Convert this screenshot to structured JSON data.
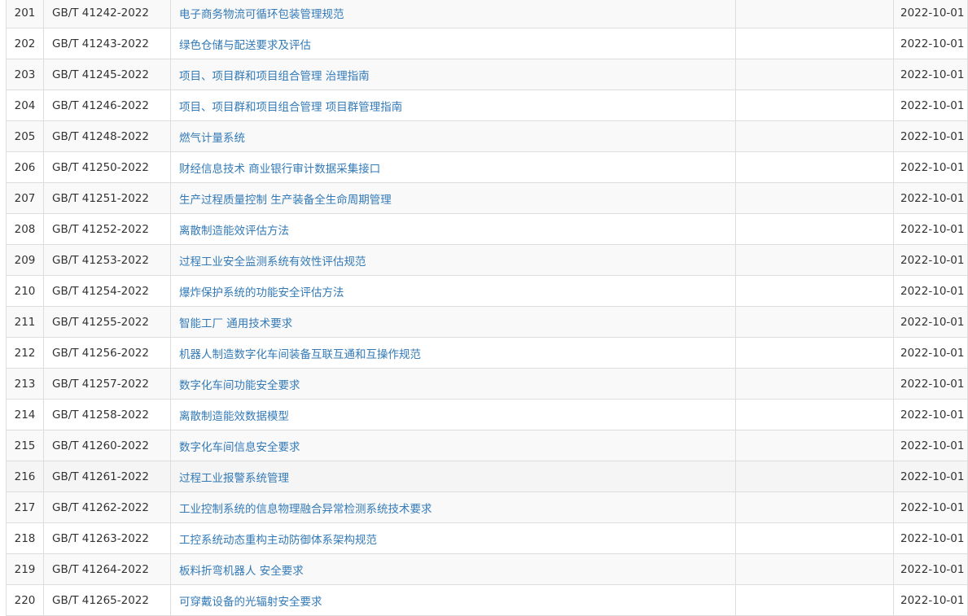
{
  "rows": [
    {
      "no": "201",
      "code": "GB/T 41242-2022",
      "title": "电子商务物流可循环包装管理规范",
      "note": "",
      "date": "2022-10-01"
    },
    {
      "no": "202",
      "code": "GB/T 41243-2022",
      "title": "绿色仓储与配送要求及评估",
      "note": "",
      "date": "2022-10-01"
    },
    {
      "no": "203",
      "code": "GB/T 41245-2022",
      "title": "项目、项目群和项目组合管理 治理指南",
      "note": "",
      "date": "2022-10-01"
    },
    {
      "no": "204",
      "code": "GB/T 41246-2022",
      "title": "项目、项目群和项目组合管理 项目群管理指南",
      "note": "",
      "date": "2022-10-01"
    },
    {
      "no": "205",
      "code": "GB/T 41248-2022",
      "title": "燃气计量系统",
      "note": "",
      "date": "2022-10-01"
    },
    {
      "no": "206",
      "code": "GB/T 41250-2022",
      "title": "财经信息技术 商业银行审计数据采集接口",
      "note": "",
      "date": "2022-10-01"
    },
    {
      "no": "207",
      "code": "GB/T 41251-2022",
      "title": "生产过程质量控制 生产装备全生命周期管理",
      "note": "",
      "date": "2022-10-01"
    },
    {
      "no": "208",
      "code": "GB/T 41252-2022",
      "title": "离散制造能效评估方法",
      "note": "",
      "date": "2022-10-01"
    },
    {
      "no": "209",
      "code": "GB/T 41253-2022",
      "title": "过程工业安全监测系统有效性评估规范",
      "note": "",
      "date": "2022-10-01"
    },
    {
      "no": "210",
      "code": "GB/T 41254-2022",
      "title": "爆炸保护系统的功能安全评估方法",
      "note": "",
      "date": "2022-10-01"
    },
    {
      "no": "211",
      "code": "GB/T 41255-2022",
      "title": "智能工厂 通用技术要求",
      "note": "",
      "date": "2022-10-01"
    },
    {
      "no": "212",
      "code": "GB/T 41256-2022",
      "title": "机器人制造数字化车间装备互联互通和互操作规范",
      "note": "",
      "date": "2022-10-01"
    },
    {
      "no": "213",
      "code": "GB/T 41257-2022",
      "title": "数字化车间功能安全要求",
      "note": "",
      "date": "2022-10-01"
    },
    {
      "no": "214",
      "code": "GB/T 41258-2022",
      "title": "离散制造能效数据模型",
      "note": "",
      "date": "2022-10-01"
    },
    {
      "no": "215",
      "code": "GB/T 41260-2022",
      "title": "数字化车间信息安全要求",
      "note": "",
      "date": "2022-10-01"
    },
    {
      "no": "216",
      "code": "GB/T 41261-2022",
      "title": "过程工业报警系统管理",
      "note": "",
      "date": "2022-10-01"
    },
    {
      "no": "217",
      "code": "GB/T 41262-2022",
      "title": "工业控制系统的信息物理融合异常检测系统技术要求",
      "note": "",
      "date": "2022-10-01"
    },
    {
      "no": "218",
      "code": "GB/T 41263-2022",
      "title": "工控系统动态重构主动防御体系架构规范",
      "note": "",
      "date": "2022-10-01"
    },
    {
      "no": "219",
      "code": "GB/T 41264-2022",
      "title": "板料折弯机器人 安全要求",
      "note": "",
      "date": "2022-10-01"
    },
    {
      "no": "220",
      "code": "GB/T 41265-2022",
      "title": "可穿戴设备的光辐射安全要求",
      "note": "",
      "date": "2022-10-01"
    }
  ],
  "colors": {
    "link": "#337ab7",
    "text": "#333333",
    "border": "#dddddd",
    "stripe": "#f9f9f9",
    "hover": "#f5f5f5"
  }
}
